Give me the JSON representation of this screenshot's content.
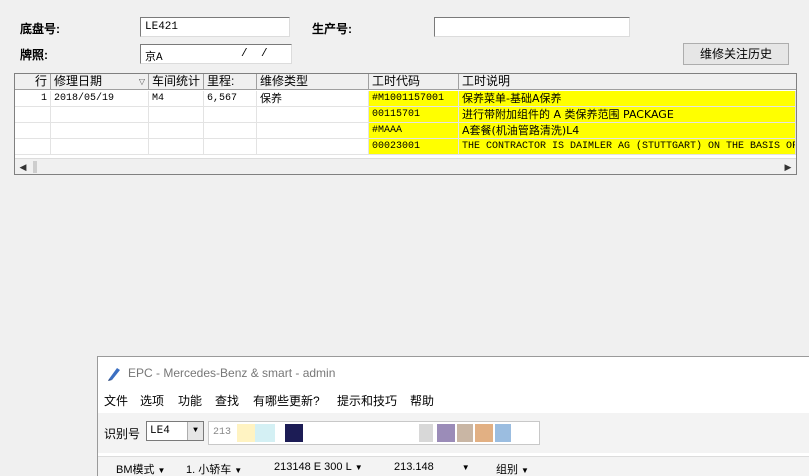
{
  "form": {
    "chassis_label": "底盘号:",
    "chassis_value": "LE421",
    "production_label": "生产号:",
    "production_value": "",
    "plate_label": "牌照:",
    "plate_prefix": "京A",
    "plate_sep1": "/",
    "plate_sep2": "/",
    "history_button": "维修关注历史"
  },
  "grid": {
    "columns": [
      "行",
      "修理日期",
      "车间统计",
      "里程:",
      "维修类型",
      "工时代码",
      "工时说明"
    ],
    "rows": [
      {
        "row": "1",
        "date": "2018/05/19",
        "workshop": "M4",
        "mileage": "6,567",
        "type": "保养",
        "code": "#M1001157001",
        "desc": "保养菜单-基础A保养"
      },
      {
        "row": "",
        "date": "",
        "workshop": "",
        "mileage": "",
        "type": "",
        "code": "00115701",
        "desc": "进行带附加组件的 A 类保养范围 PACKAGE"
      },
      {
        "row": "",
        "date": "",
        "workshop": "",
        "mileage": "",
        "type": "",
        "code": "#MAAA",
        "desc": "A套餐(机油管路清洗)L4"
      },
      {
        "row": "",
        "date": "",
        "workshop": "",
        "mileage": "",
        "type": "",
        "code": "00023001",
        "desc": "THE CONTRACTOR IS DAIMLER AG (STUTTGART) ON THE BASIS OF A"
      }
    ]
  },
  "epc": {
    "title": "EPC - Mercedes-Benz & smart - admin",
    "menu": [
      "文件",
      "选项",
      "功能",
      "查找",
      "有哪些更新?",
      "提示和技巧",
      "帮助"
    ],
    "id_label": "识别号",
    "id_select": "LE4",
    "id_value": "213",
    "status": {
      "mode": "BM模式",
      "category": "1. 小轿车",
      "model": "213148 E 300 L",
      "code": "213.148",
      "group": "组别"
    },
    "colors": {
      "highlight": "#ffff00",
      "swatches": [
        "#fff3c2",
        "#d4f0f4",
        "#1c1c55",
        "#d8d8d8",
        "#9b8cb8",
        "#c9b6a4",
        "#e2b083",
        "#9bbde0"
      ]
    }
  }
}
